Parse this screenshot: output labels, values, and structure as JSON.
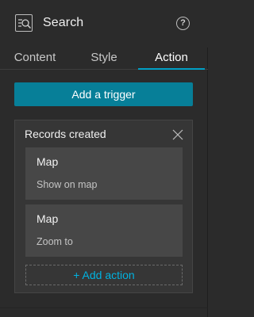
{
  "header": {
    "title": "Search",
    "help_label": "?",
    "widget_icon": "search-widget-icon",
    "help_icon": "help-icon"
  },
  "tabs": [
    {
      "label": "Content",
      "active": false
    },
    {
      "label": "Style",
      "active": false
    },
    {
      "label": "Action",
      "active": true
    }
  ],
  "trigger": {
    "add_label": "Add a trigger"
  },
  "records": {
    "title": "Records created",
    "actions": [
      {
        "title": "Map",
        "subtitle": "Show on map"
      },
      {
        "title": "Map",
        "subtitle": "Zoom to"
      }
    ],
    "add_action_label": "+ Add action"
  },
  "colors": {
    "accent": "#00a0c6",
    "button": "#077f98",
    "background": "#2b2b2b"
  }
}
